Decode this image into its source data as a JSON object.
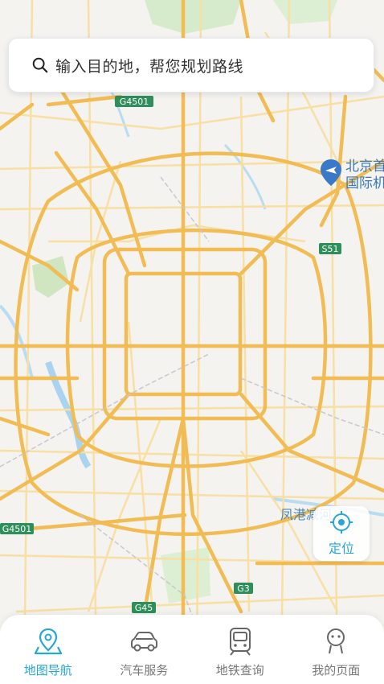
{
  "search": {
    "placeholder": "输入目的地，帮您规划路线"
  },
  "map": {
    "road_labels": [
      "G4501",
      "G4501",
      "S51",
      "G45",
      "G3"
    ],
    "place_labels": [
      "北京首都",
      "国际机场",
      "凤港减河"
    ]
  },
  "locate": {
    "label": "定位"
  },
  "tabs": [
    {
      "label": "地图导航",
      "active": true
    },
    {
      "label": "汽车服务",
      "active": false
    },
    {
      "label": "地铁查询",
      "active": false
    },
    {
      "label": "我的页面",
      "active": false
    }
  ],
  "colors": {
    "accent": "#27a7d4",
    "road_major": "#f3bf5c",
    "road_minor": "#f8dd9a",
    "water": "#a9d3ee",
    "park": "#cfe8c5"
  }
}
